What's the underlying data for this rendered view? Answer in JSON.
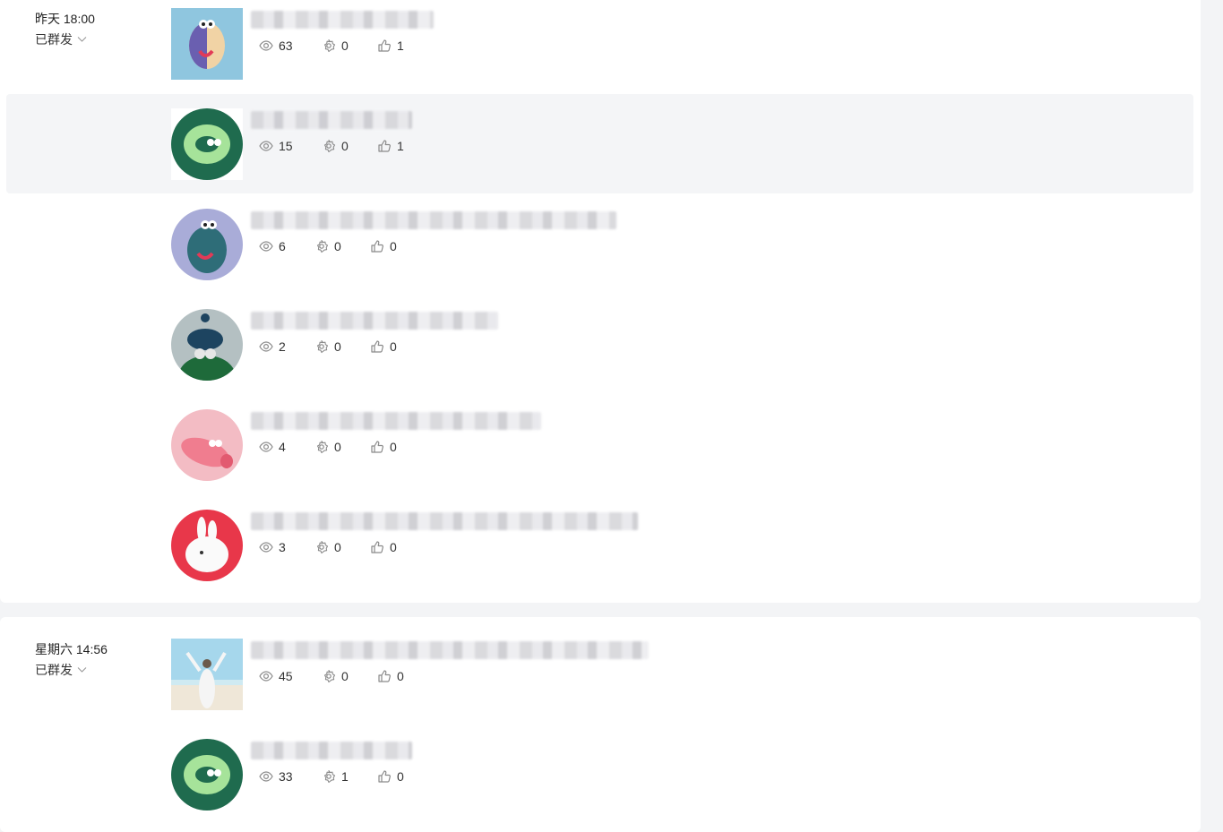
{
  "groups": [
    {
      "date": "昨天 18:00",
      "status": "已群发",
      "items": [
        {
          "title": "",
          "views": "63",
          "shares": "0",
          "likes": "1"
        },
        {
          "title": "",
          "views": "15",
          "shares": "0",
          "likes": "1"
        },
        {
          "title": "",
          "views": "6",
          "shares": "0",
          "likes": "0"
        },
        {
          "title": "",
          "views": "2",
          "shares": "0",
          "likes": "0"
        },
        {
          "title": "",
          "views": "4",
          "shares": "0",
          "likes": "0"
        },
        {
          "title": "",
          "views": "3",
          "shares": "0",
          "likes": "0"
        }
      ]
    },
    {
      "date": "星期六 14:56",
      "status": "已群发",
      "items": [
        {
          "title": "",
          "views": "45",
          "shares": "0",
          "likes": "0"
        },
        {
          "title": "",
          "views": "33",
          "shares": "1",
          "likes": "0"
        }
      ]
    }
  ],
  "icons": {
    "views": "eye-icon",
    "shares": "share-gear-icon",
    "likes": "thumbs-up-icon",
    "status_dropdown": "chevron-down-icon"
  },
  "colors": {
    "page_background": "#f3f4f6",
    "card_background": "#ffffff",
    "row_highlight": "#f4f5f7",
    "text": "#333333",
    "icon": "#8a8a8a"
  }
}
